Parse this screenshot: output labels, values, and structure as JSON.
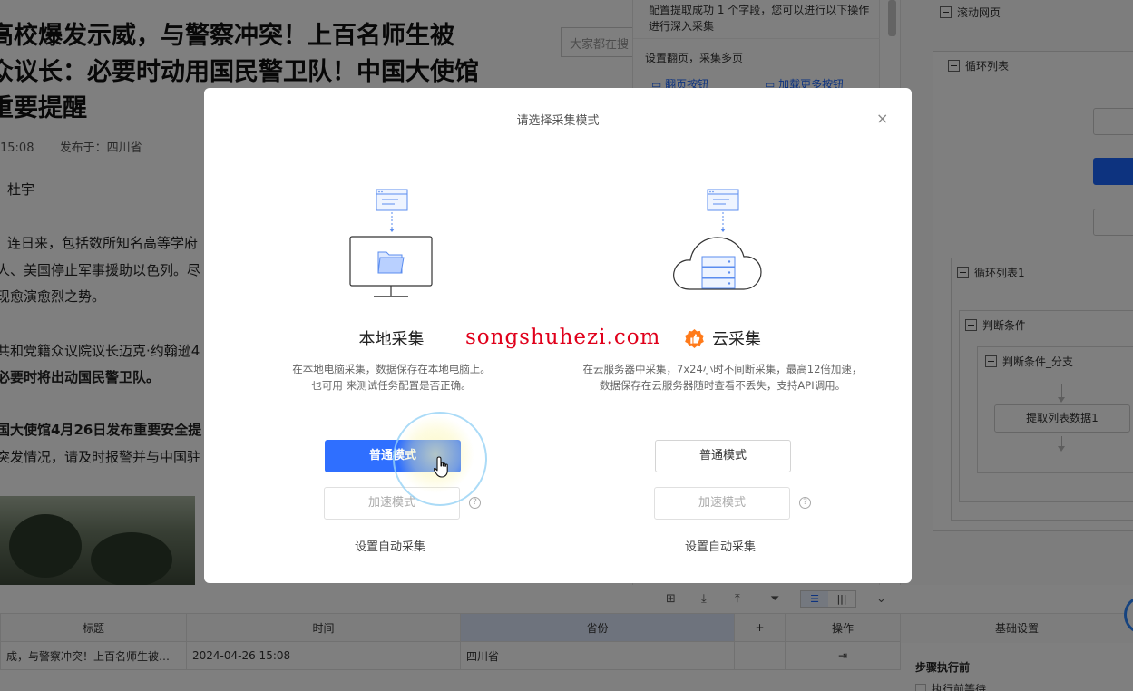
{
  "article": {
    "headline": "高校爆发示威，与警察冲突！上百名师生被\n众议长：必要时动用国民警卫队！中国大使馆\n重要提醒",
    "search_placeholder": "大家都在搜",
    "time": "15:08",
    "published_in": "发布于：四川省",
    "author": "杜宇",
    "para1": "连日来，包括数所知名高等学府",
    "para2": "人、美国停止军事援助以色列。尽",
    "para3": "现愈演愈烈之势。",
    "para4": "共和党籍众议院议长迈克·约翰逊4",
    "para5": "必要时将出动国民警卫队。",
    "para6": "国大使馆4月26日发布重要安全提",
    "para7": "突发情况，请及时报警并与中国驻"
  },
  "mid_panel": {
    "tip": "配置提取成功 1 个字段，您可以进行以下操作进行深入采集",
    "pagination_title": "设置翻页，采集多页",
    "link_next_page": "翻页按钮",
    "link_load_more": "加载更多按钮"
  },
  "workflow": {
    "scroll_page": "滚动网页",
    "loop_list": "循环列表",
    "loop_list_1": "循环列表1",
    "condition": "判断条件",
    "condition_branch": "判断条件_分支",
    "extract_data": "提取列表数据1"
  },
  "table": {
    "headers": [
      "标题",
      "时间",
      "省份",
      "+",
      "操作"
    ],
    "row": {
      "title": "成，与警察冲突！上百名师生被捕，…",
      "time": "2024-04-26 15:08",
      "province": "四川省",
      "extra": ""
    },
    "toggle_list": "☰",
    "toggle_cols": "|||"
  },
  "settings": {
    "tab": "基础设置",
    "pre_step": "步骤执行前",
    "pre_wait": "执行前等待"
  },
  "modal": {
    "title": "请选择采集模式",
    "close": "×",
    "local": {
      "name": "本地采集",
      "desc": "在本地电脑采集，数据保存在本地电脑上。\n也可用 来测试任务配置是否正确。",
      "normal_mode": "普通模式",
      "fast_mode": "加速模式",
      "auto": "设置自动采集"
    },
    "cloud": {
      "name": "云采集",
      "desc": "在云服务器中采集，7x24小时不间断采集，最高12倍加速，\n数据保存在云服务器随时查看不丢失，支持API调用。",
      "normal_mode": "普通模式",
      "fast_mode": "加速模式",
      "auto": "设置自动采集"
    },
    "help": "?",
    "watermark": "songshuhezi.com"
  },
  "colors": {
    "primary": "#2f6fff",
    "watermark": "#e0001b",
    "badge": "#ff7a1a"
  },
  "icons": [
    "folder-icon",
    "monitor-icon",
    "cloud-icon",
    "server-icon",
    "browser-window-icon",
    "thumbs-up-badge-icon",
    "close-icon",
    "help-icon",
    "hand-pointer-icon"
  ]
}
